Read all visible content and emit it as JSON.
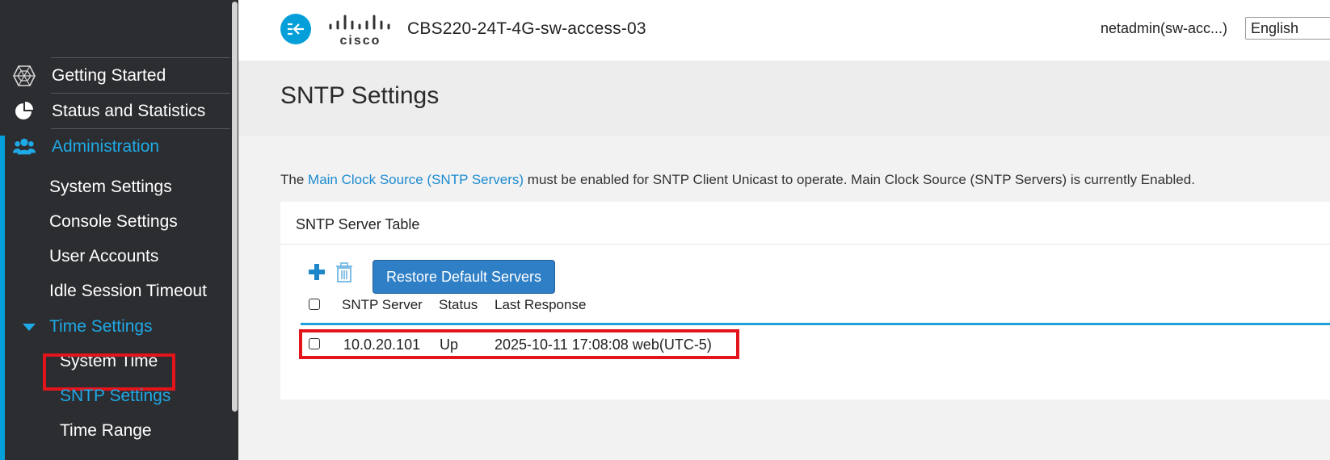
{
  "header": {
    "device_name": "CBS220-24T-4G-sw-access-03",
    "user": "netadmin(sw-acc...)",
    "language": "English"
  },
  "sidebar": {
    "items": [
      {
        "label": "Getting Started",
        "icon": "hexagon-icon"
      },
      {
        "label": "Status and Statistics",
        "icon": "pie-chart-icon"
      },
      {
        "label": "Administration",
        "icon": "users-icon"
      }
    ],
    "admin_subitems": [
      {
        "label": "System Settings"
      },
      {
        "label": "Console Settings"
      },
      {
        "label": "User Accounts"
      },
      {
        "label": "Idle Session Timeout"
      }
    ],
    "time_settings": {
      "label": "Time Settings",
      "children": [
        {
          "label": "System Time"
        },
        {
          "label": "SNTP Settings"
        },
        {
          "label": "Time Range"
        }
      ]
    }
  },
  "page": {
    "title": "SNTP Settings",
    "info_prefix": "The ",
    "info_link": "Main Clock Source (SNTP Servers)",
    "info_suffix": " must be enabled for SNTP Client Unicast to operate. Main Clock Source (SNTP Servers) is currently Enabled."
  },
  "table": {
    "title": "SNTP Server Table",
    "restore_button": "Restore Default Servers",
    "columns": [
      "SNTP Server",
      "Status",
      "Last Response"
    ],
    "rows": [
      {
        "server": "10.0.20.101",
        "status": "Up",
        "last_response": "2025-10-11 17:08:08 web(UTC-5)"
      }
    ]
  },
  "colors": {
    "accent": "#049fd9",
    "sidebar_bg": "#2c2d30",
    "highlight": "#e3141c",
    "button": "#2f7fc6"
  }
}
